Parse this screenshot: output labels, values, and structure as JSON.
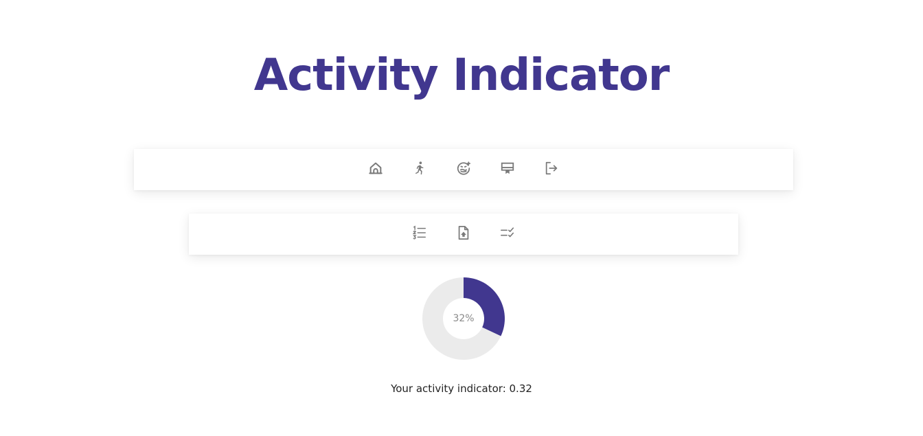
{
  "title": "Activity Indicator",
  "main_nav": {
    "items": [
      {
        "icon": "home-icon"
      },
      {
        "icon": "running-person-icon"
      },
      {
        "icon": "face-mask-icon"
      },
      {
        "icon": "certificate-icon"
      },
      {
        "icon": "logout-icon"
      }
    ]
  },
  "sub_nav": {
    "items": [
      {
        "icon": "numbered-list-icon"
      },
      {
        "icon": "file-upload-icon"
      },
      {
        "icon": "checklist-icon"
      }
    ]
  },
  "indicator": {
    "percent_label": "32%",
    "caption": "Your activity indicator: 0.32"
  },
  "chart_data": {
    "type": "pie",
    "values": [
      0.32,
      0.68
    ],
    "colors": [
      "#41378f",
      "#ebebeb"
    ],
    "center_label": "32%"
  },
  "colors": {
    "accent": "#41378f",
    "track": "#ebebeb",
    "icon": "#7a7a7a"
  }
}
